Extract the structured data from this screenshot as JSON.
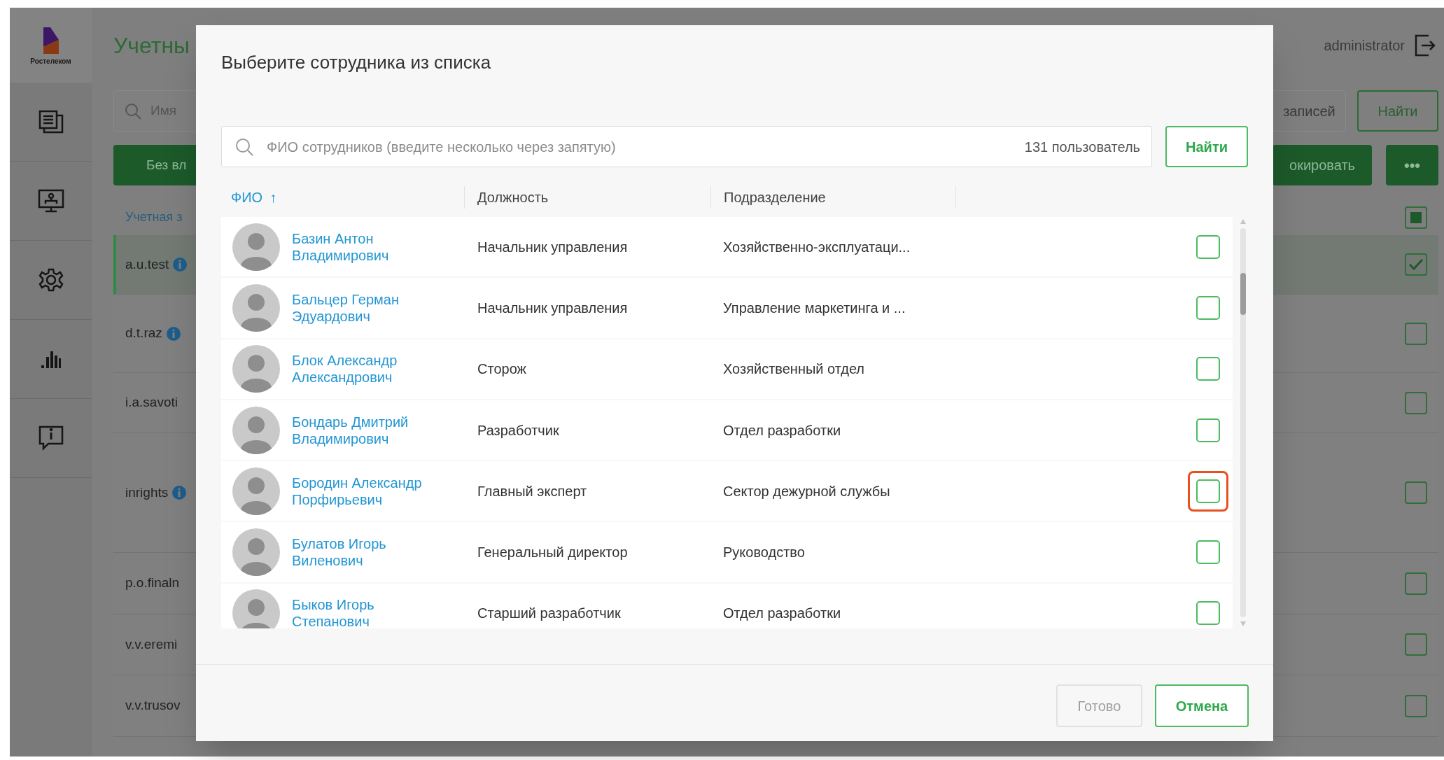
{
  "sidebar": {
    "logo_text": "Ростелеком"
  },
  "page": {
    "title": "Учетны",
    "search_placeholder": "Имя",
    "filter_button": "Без вл",
    "column_1": "Учетная з",
    "user": "administrator",
    "records_button": "записей",
    "find_button": "Найти",
    "block_button": "окировать",
    "more_button": "•••",
    "header_checkbox_indeterminate": true,
    "rows": [
      {
        "login": "a.u.test",
        "info": true,
        "selected": true,
        "checked": true
      },
      {
        "login": "d.t.raz",
        "info": true,
        "selected": false,
        "checked": false
      },
      {
        "login": "i.a.savoti",
        "info": false,
        "selected": false,
        "checked": false
      },
      {
        "login": "inrights",
        "info": true,
        "selected": false,
        "checked": false
      },
      {
        "login": "p.o.finaln",
        "info": false,
        "selected": false,
        "checked": false
      },
      {
        "login": "v.v.eremi",
        "info": false,
        "selected": false,
        "checked": false
      },
      {
        "login": "v.v.trusov",
        "info": false,
        "selected": false,
        "checked": false
      }
    ]
  },
  "dialog": {
    "title": "Выберите сотрудника из списка",
    "search": {
      "placeholder": "ФИО сотрудников (введите несколько через запятую)",
      "count": "131 пользователь"
    },
    "search_button": "Найти",
    "columns": [
      {
        "label": "ФИО",
        "sort_arrow": "↑",
        "sorted": true
      },
      {
        "label": "Должность",
        "sorted": false
      },
      {
        "label": "Подразделение",
        "sorted": false
      }
    ],
    "rows": [
      {
        "name": "Базин Антон Владимирович",
        "position": "Начальник управления",
        "department": "Хозяйственно-эксплуатаци...",
        "checked": false,
        "highlighted": false
      },
      {
        "name": "Бальцер Герман Эдуардович",
        "position": "Начальник управления",
        "department": "Управление маркетинга и ...",
        "checked": false,
        "highlighted": false
      },
      {
        "name": "Блок Александр Александрович",
        "position": "Сторож",
        "department": "Хозяйственный отдел",
        "checked": false,
        "highlighted": false
      },
      {
        "name": "Бондарь Дмитрий Владимирович",
        "position": "Разработчик",
        "department": "Отдел разработки",
        "checked": false,
        "highlighted": false
      },
      {
        "name": "Бородин Александр Порфирьевич",
        "position": "Главный эксперт",
        "department": "Сектор дежурной службы",
        "checked": false,
        "highlighted": true
      },
      {
        "name": "Булатов Игорь Виленович",
        "position": "Генеральный директор",
        "department": "Руководство",
        "checked": false,
        "highlighted": false
      },
      {
        "name": "Быков Игорь Степанович",
        "position": "Старший разработчик",
        "department": "Отдел разработки",
        "checked": false,
        "highlighted": false
      }
    ],
    "buttons": [
      {
        "label": "Готово",
        "disabled": true
      },
      {
        "label": "Отмена",
        "disabled": false
      }
    ]
  }
}
